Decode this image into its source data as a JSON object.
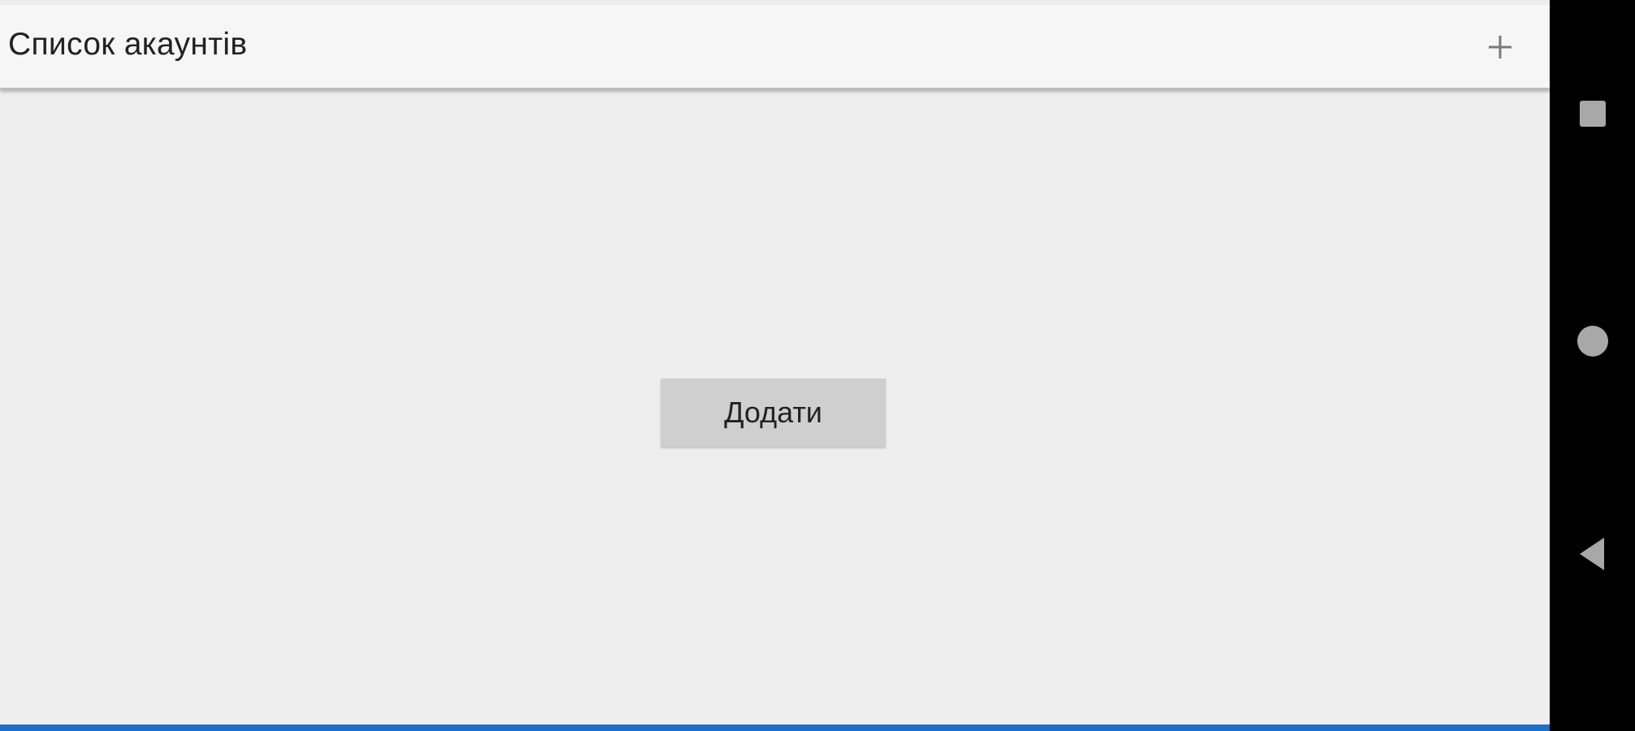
{
  "app_bar": {
    "title": "Список акаунтів",
    "add_icon": "plus-icon"
  },
  "main": {
    "add_button_label": "Додати"
  },
  "nav_bar": {
    "buttons": [
      "recents-square-icon",
      "home-circle-icon",
      "back-triangle-icon"
    ]
  },
  "colors": {
    "toolbar_bg": "#f6f6f6",
    "content_bg": "#eeeeee",
    "button_bg": "#cfcfcf",
    "accent_bottom": "#1e6fc8",
    "nav_bg": "#000000",
    "nav_icon": "#a8a8a8"
  }
}
